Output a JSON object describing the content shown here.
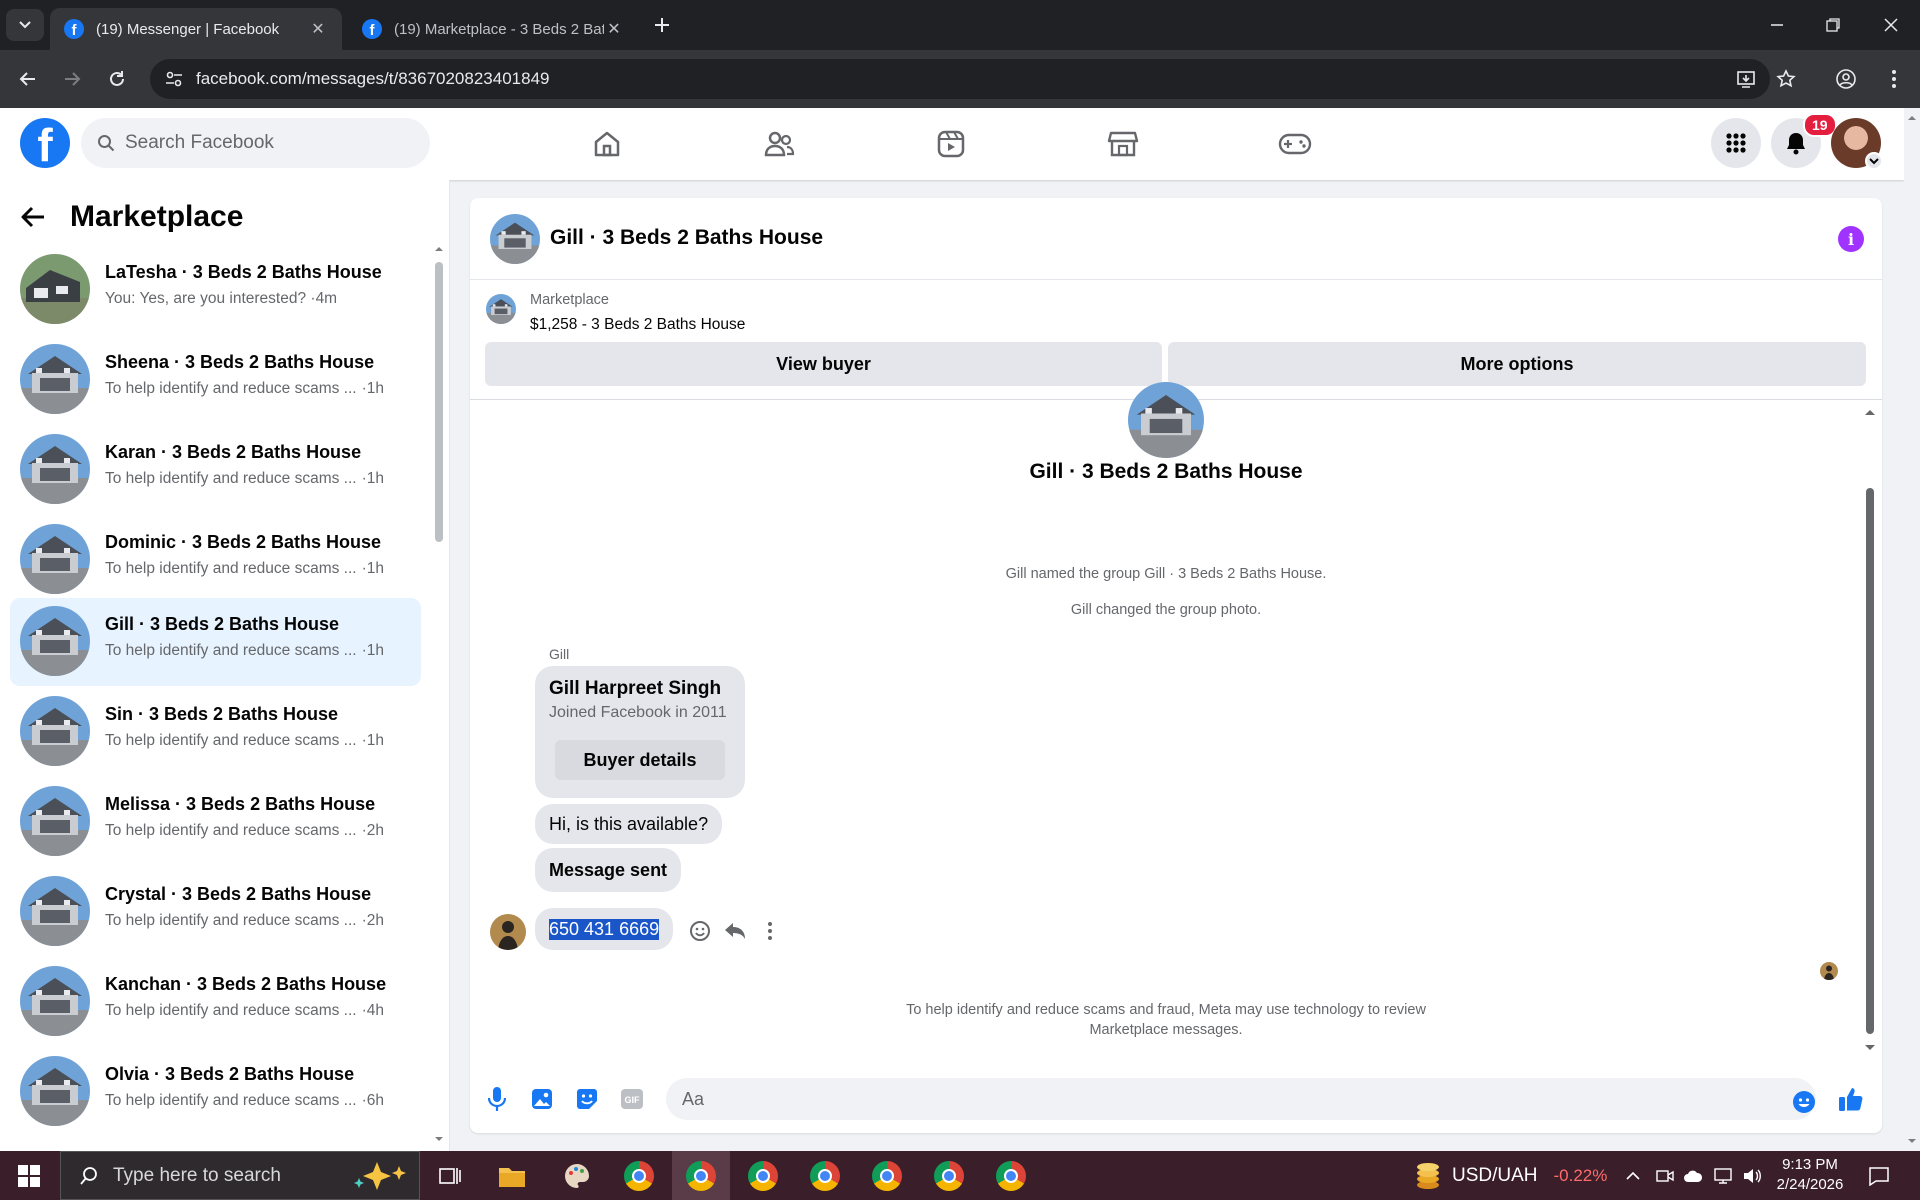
{
  "browser": {
    "tabs": [
      {
        "title": "(19) Messenger | Facebook",
        "active": true
      },
      {
        "title": "(19) Marketplace - 3 Beds 2 Bat",
        "active": false
      }
    ],
    "url": "facebook.com/messages/t/8367020823401849"
  },
  "header": {
    "search_placeholder": "Search Facebook",
    "notification_count": "19",
    "nav_icons": [
      "home-icon",
      "friends-icon",
      "video-icon",
      "marketplace-icon",
      "gaming-icon"
    ]
  },
  "sidebar": {
    "title": "Marketplace",
    "conversations": [
      {
        "name": "LaTesha · 3 Beds 2 Baths House",
        "preview": "You: Yes, are you interested? · ",
        "time": "4m",
        "selected": false
      },
      {
        "name": "Sheena · 3 Beds 2 Baths House",
        "preview": "To help identify and reduce scams ...",
        "time": "·1h",
        "selected": false
      },
      {
        "name": "Karan · 3 Beds 2 Baths House",
        "preview": "To help identify and reduce scams ...",
        "time": "·1h",
        "selected": false
      },
      {
        "name": "Dominic · 3 Beds 2 Baths House",
        "preview": "To help identify and reduce scams ...",
        "time": "·1h",
        "selected": false
      },
      {
        "name": "Gill · 3 Beds 2 Baths House",
        "preview": "To help identify and reduce scams ...",
        "time": "·1h",
        "selected": true
      },
      {
        "name": "Sin · 3 Beds 2 Baths House",
        "preview": "To help identify and reduce scams ...",
        "time": "·1h",
        "selected": false
      },
      {
        "name": "Melissa · 3 Beds 2 Baths House",
        "preview": "To help identify and reduce scams ...",
        "time": "·2h",
        "selected": false
      },
      {
        "name": "Crystal · 3 Beds 2 Baths House",
        "preview": "To help identify and reduce scams ...",
        "time": "·2h",
        "selected": false
      },
      {
        "name": "Kanchan · 3 Beds 2 Baths House",
        "preview": "To help identify and reduce scams ...",
        "time": "·4h",
        "selected": false
      },
      {
        "name": "Olvia · 3 Beds 2 Baths House",
        "preview": "To help identify and reduce scams ...",
        "time": "·6h",
        "selected": false
      }
    ]
  },
  "chat": {
    "title": "Gill · 3 Beds 2 Baths House",
    "listing": {
      "source": "Marketplace",
      "description": "$1,258 - 3 Beds 2 Baths House",
      "view_buyer": "View buyer",
      "more_options": "More options"
    },
    "system_messages": [
      "Gill named the group Gill · 3 Beds 2 Baths House.",
      "Gill changed the group photo."
    ],
    "sender": "Gill",
    "buyer_card": {
      "name": "Gill Harpreet Singh",
      "joined": "Joined Facebook in 2011",
      "button": "Buyer details"
    },
    "messages": [
      "Hi, is this available?",
      "Message sent",
      "650 431 6669"
    ],
    "notice": "To help identify and reduce scams and fraud, Meta may use technology to review Marketplace messages.",
    "input_placeholder": "Aa"
  },
  "taskbar": {
    "search_placeholder": "Type here to search",
    "ticker_label": "USD/UAH",
    "ticker_change": "-0.22%",
    "time": "9:13 PM",
    "date": "2/24/2026"
  },
  "colors": {
    "brand": "#1877f2",
    "selected_row": "#e7f3ff",
    "info": "#a033ff",
    "badge": "#e41e3f"
  }
}
